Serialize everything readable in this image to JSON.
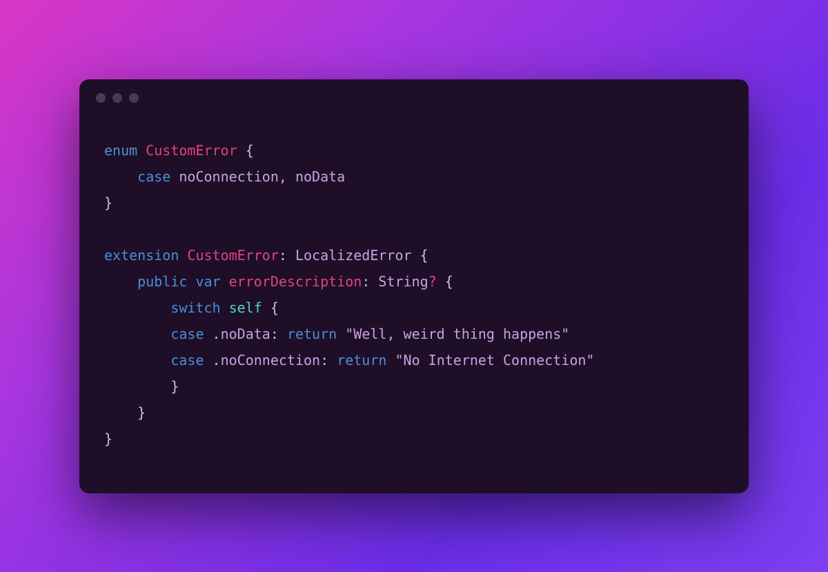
{
  "code": {
    "l1": {
      "kw_enum": "enum",
      "type": "CustomError",
      "open": " {"
    },
    "l2": {
      "indent": "    ",
      "kw_case": "case",
      "ids": " noConnection, noData"
    },
    "l3": {
      "close": "}"
    },
    "l4": {
      "blank": ""
    },
    "l5": {
      "kw_ext": "extension",
      "type": " CustomError",
      "colon": ": ",
      "proto": "LocalizedError",
      "open": " {"
    },
    "l6": {
      "indent": "    ",
      "kw_pub": "public",
      "sp1": " ",
      "kw_var": "var",
      "sp2": " ",
      "name": "errorDescription",
      "colon": ": ",
      "rettype": "String",
      "q": "?",
      "open": " {"
    },
    "l7": {
      "indent": "        ",
      "kw_switch": "switch",
      "sp": " ",
      "self": "self",
      "open": " {"
    },
    "l8": {
      "indent": "        ",
      "kw_case": "case",
      "dot": " .",
      "id": "noData",
      "colon": ": ",
      "kw_ret": "return",
      "sp": " ",
      "str": "\"Well, weird thing happens\""
    },
    "l9": {
      "indent": "        ",
      "kw_case": "case",
      "dot": " .",
      "id": "noConnection",
      "colon": ": ",
      "kw_ret": "return",
      "sp": " ",
      "str": "\"No Internet Connection\""
    },
    "l10": {
      "indent": "        ",
      "close": "}"
    },
    "l11": {
      "indent": "    ",
      "close": "}"
    },
    "l12": {
      "close": "}"
    }
  }
}
